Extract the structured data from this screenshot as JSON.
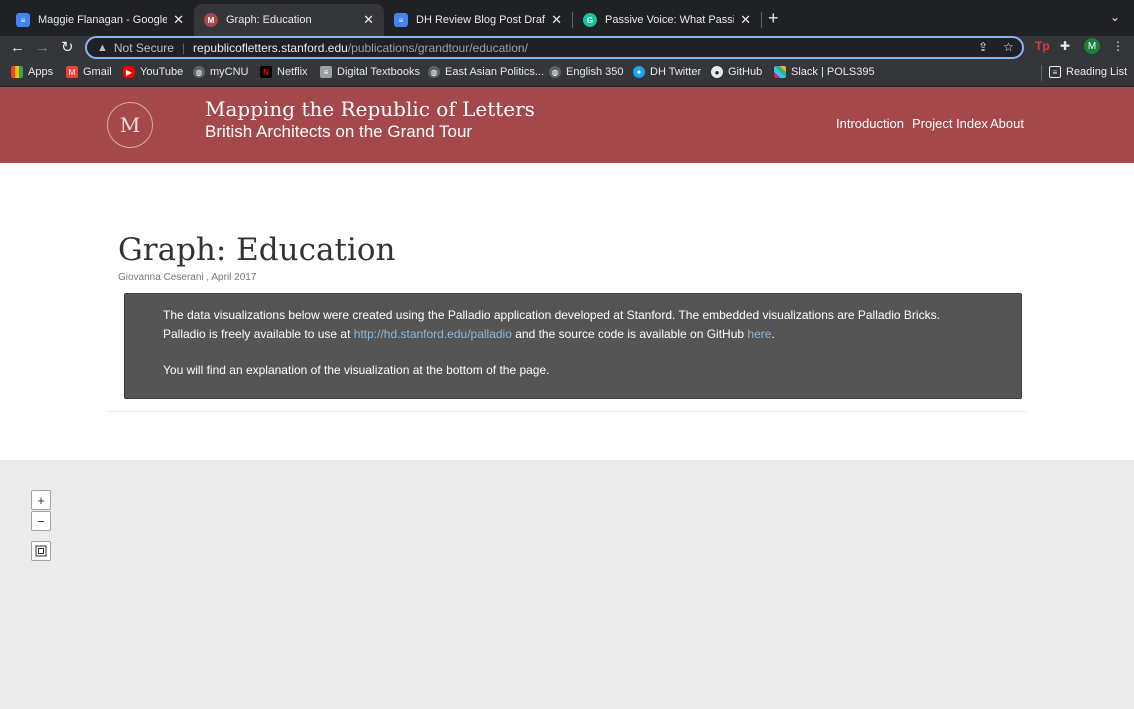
{
  "browser": {
    "tabs": [
      {
        "title": "Maggie Flanagan - Google Doc",
        "icon_color": "#4285f4",
        "icon": "docs-icon"
      },
      {
        "title": "Graph: Education",
        "icon_color": "#a4484c",
        "icon": "site-favicon"
      },
      {
        "title": "DH Review Blog Post Draft - Go",
        "icon_color": "#4285f4",
        "icon": "docs-icon"
      },
      {
        "title": "Passive Voice: What Passive Vo",
        "icon_color": "#15c39a",
        "icon": "grammarly-icon"
      }
    ],
    "address": {
      "security": "Not Secure",
      "domain": "republicofletters.stanford.edu",
      "path": "/publications/grandtour/education/"
    },
    "profile_initial": "M",
    "bookmarks": [
      {
        "label": "Apps",
        "icon_color": "#ea4335"
      },
      {
        "label": "Gmail",
        "icon_color": "#ea4335"
      },
      {
        "label": "YouTube",
        "icon_color": "#ff0000"
      },
      {
        "label": "myCNU",
        "icon_color": "#5f6368"
      },
      {
        "label": "Netflix",
        "icon_color": "#e50914"
      },
      {
        "label": "Digital Textbooks",
        "icon_color": "#9aa0a6"
      },
      {
        "label": "East Asian Politics...",
        "icon_color": "#5f6368"
      },
      {
        "label": "English 350",
        "icon_color": "#5f6368"
      },
      {
        "label": "DH Twitter",
        "icon_color": "#1da1f2"
      },
      {
        "label": "GitHub",
        "icon_color": "#5f6368"
      },
      {
        "label": "Slack | POLS395",
        "icon_color": "#e01e5a"
      }
    ],
    "reading_list": "Reading List"
  },
  "site": {
    "logo_letter": "M",
    "title": "Mapping the Republic of Letters",
    "subtitle": "British Architects on the Grand Tour",
    "nav": [
      "Introduction",
      "Project Index",
      "About"
    ],
    "brand_color": "#a4484c"
  },
  "page": {
    "title": "Graph: Education",
    "byline": "Giovanna Ceserani , April 2017",
    "info": {
      "text1": "The data visualizations below were created using the Palladio application developed at Stanford. The embedded visualizations are Palladio Bricks. Palladio is freely available to use at ",
      "link1": "http://hd.stanford.edu/palladio",
      "text2": " and the source code is available on GitHub ",
      "link2": "here",
      "text3": ".",
      "paragraph2": "You will find an explanation of the visualization at the bottom of the page."
    }
  },
  "viz": {
    "zoom_in": "+",
    "zoom_out": "−"
  }
}
